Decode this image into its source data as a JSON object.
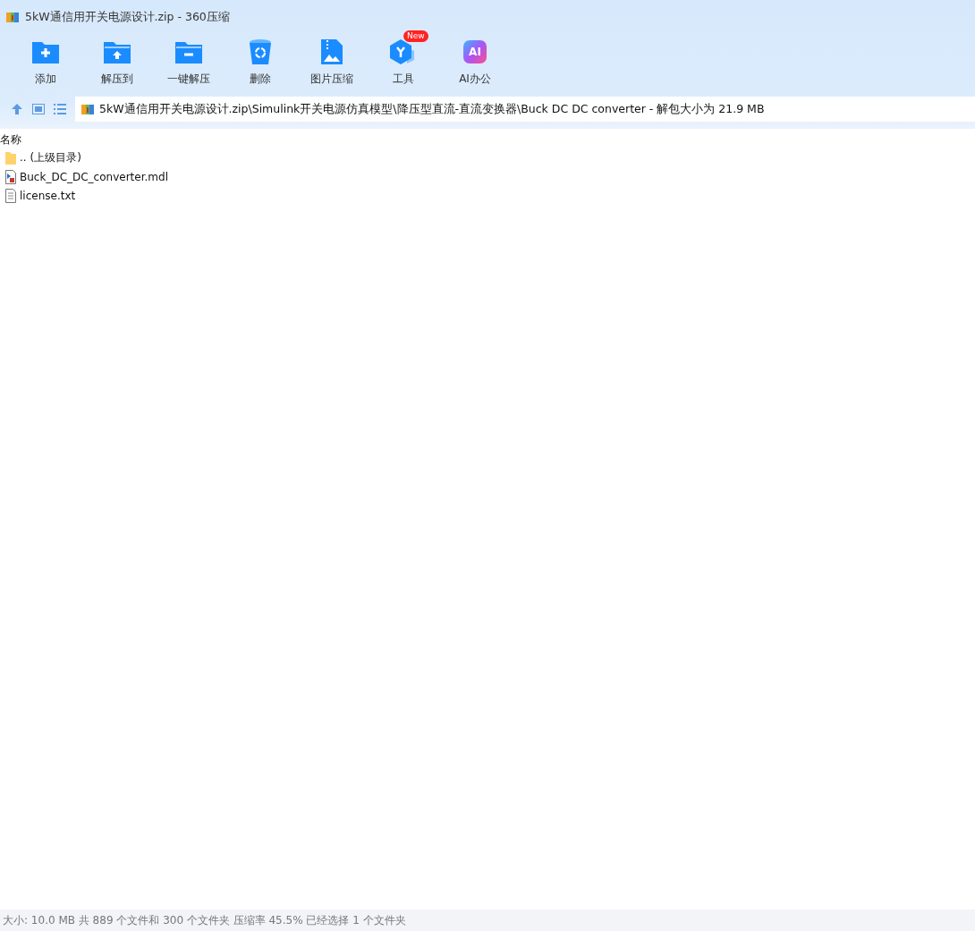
{
  "window": {
    "title": "5kW通信用开关电源设计.zip - 360压缩"
  },
  "toolbar": [
    {
      "kind": "add",
      "label": "添加"
    },
    {
      "kind": "extract",
      "label": "解压到"
    },
    {
      "kind": "oneclick",
      "label": "一键解压"
    },
    {
      "kind": "delete",
      "label": "删除"
    },
    {
      "kind": "image",
      "label": "图片压缩"
    },
    {
      "kind": "tools",
      "label": "工具",
      "badge": "New"
    },
    {
      "kind": "ai",
      "label": "AI办公",
      "glyph": "AI"
    }
  ],
  "address_bar": {
    "path": "5kW通信用开关电源设计.zip\\Simulink开关电源仿真模型\\降压型直流-直流变换器\\Buck DC DC converter - 解包大小为 21.9 MB"
  },
  "file_list": {
    "columns": [
      "名称"
    ],
    "rows": [
      {
        "kind": "folder",
        "name": ".. (上级目录)"
      },
      {
        "kind": "model",
        "name": "Buck_DC_DC_converter.mdl"
      },
      {
        "kind": "text",
        "name": "license.txt"
      }
    ]
  },
  "status_bar": "大小: 10.0 MB 共 889 个文件和 300 个文件夹 压缩率 45.5% 已经选择 1 个文件夹"
}
